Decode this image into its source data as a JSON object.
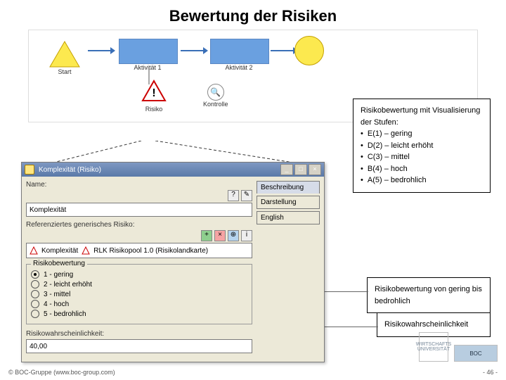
{
  "title": "Bewertung der Risiken",
  "diagram": {
    "start": "Start",
    "act1": "Aktivität 1",
    "act2": "Aktivität 2",
    "risk_label": "Risiko",
    "risk_mark": "!",
    "control_label": "Kontrolle"
  },
  "box_levels": {
    "intro": "Risikobewertung mit Visualisierung der Stufen:",
    "items": [
      "E(1) – gering",
      "D(2) – leicht erhöht",
      "C(3) – mittel",
      "B(4) – hoch",
      "A(5) – bedrohlich"
    ]
  },
  "box_range": "Risikobewertung von gering bis bedrohlich",
  "box_prob": "Risikowahr­scheinlichkeit",
  "dialog": {
    "title": "Komplexität (Risiko)",
    "name_label": "Name:",
    "name_value": "Komplexität",
    "ref_label": "Referenziertes generisches Risiko:",
    "ref_value": "Komplexität",
    "ref_pool": "RLK Risikopool 1.0 (Risikolandkarte)",
    "eval_legend": "Risikobewertung",
    "radios": [
      "1 - gering",
      "2 - leicht erhöht",
      "3 - mittel",
      "4 - hoch",
      "5 - bedrohlich"
    ],
    "radio_selected": 0,
    "prob_label": "Risikowahrscheinlichkeit:",
    "prob_value": "40,00",
    "tabs": [
      "Beschreibung",
      "Darstellung",
      "English"
    ]
  },
  "footer": {
    "copyright": "© BOC-Gruppe (www.boc-group.com)",
    "page": "- 46 -"
  },
  "logos": {
    "wu": "WIRTSCHAFTS UNIVERSITÄT",
    "boc": "BOC"
  }
}
